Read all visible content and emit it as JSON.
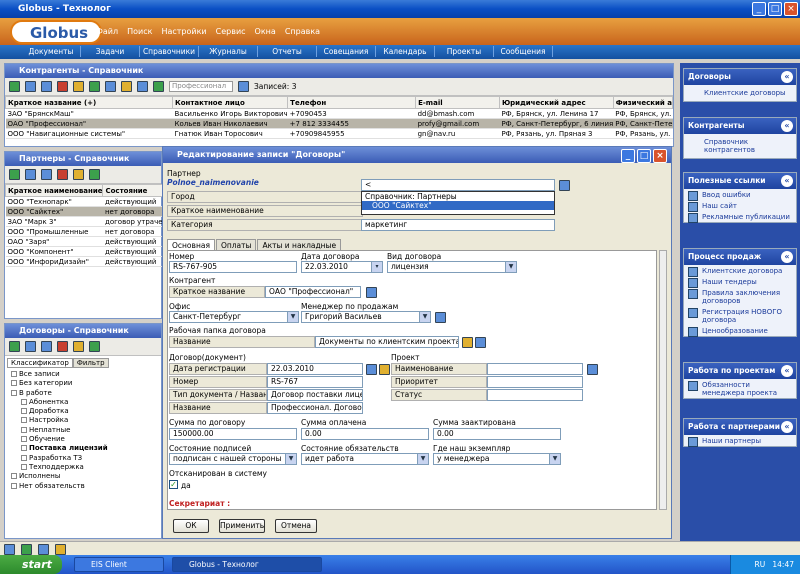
{
  "window": {
    "title": "Globus - Технолог"
  },
  "app": {
    "logo": "Globus",
    "menu": [
      "Файл",
      "Поиск",
      "Настройки",
      "Сервис",
      "Окна",
      "Справка"
    ]
  },
  "nav": {
    "tabs": [
      "Документы",
      "Задачи",
      "Справочники",
      "Журналы",
      "Отчеты",
      "Совещания",
      "Календарь",
      "Проекты",
      "Сообщения"
    ]
  },
  "contractors": {
    "title": "Контрагенты - Справочник",
    "filter_placeholder": "Профессионал",
    "records_label": "Записей: 3",
    "columns": [
      "Краткое название (+)",
      "Контактное лицо",
      "Телефон",
      "E-mail",
      "Юридический адрес",
      "Физический а"
    ],
    "rows": [
      [
        "ЗАО \"БрянскМаш\"",
        "Васильенко Игорь Викторович",
        "+7090453",
        "dd@bmash.com",
        "РФ, Брянск, ул. Ленина 17",
        "РФ, Брянск, ул."
      ],
      [
        "ОАО \"Профессионал\"",
        "Кольев Иван Николаевич",
        "+7 812 3334455",
        "profy@gmail.com",
        "РФ, Санкт-Петербург, 6 линия",
        "РФ, Санкт-Пете"
      ],
      [
        "ООО \"Навигационные системы\"",
        "Гнатюк Иван Торосович",
        "+70909845955",
        "gn@nav.ru",
        "РФ, Рязань, ул. Пряная 3",
        "РФ, Рязань, ул."
      ]
    ]
  },
  "partners": {
    "title": "Партнеры - Справочник",
    "columns": [
      "Краткое наименование",
      "Состояние"
    ],
    "rows": [
      [
        "ООО \"Технопарк\"",
        "действующий"
      ],
      [
        "ООО \"Сайктех\"",
        "нет договора"
      ],
      [
        "ЗАО \"Марк 3\"",
        "договор утрачен"
      ],
      [
        "ООО \"Промышленные",
        "нет договора"
      ],
      [
        "ОАО \"Заря\"",
        "действующий"
      ],
      [
        "ООО \"Компонент\"",
        "действующий"
      ],
      [
        "ООО \"ИнфориДизайн\"",
        "действующий"
      ]
    ]
  },
  "contracts": {
    "title": "Договоры - Справочник",
    "tabs": [
      "Классификатор",
      "Фильтр"
    ],
    "tree": [
      "Все записи",
      "Без категории",
      "В работе",
      "Абонентка",
      "Доработка",
      "Настройка",
      "Неплатные",
      "Обучение",
      "Поставка лицензий",
      "Разработка ТЗ",
      "Техподдержка",
      "Исполнены",
      "Нет обязательств"
    ]
  },
  "dialog": {
    "title": "Редактирование записи \"Договоры\"",
    "partner_label": "Партнер",
    "partner_field": "Polnoe_naimenovanie",
    "city_label": "Город",
    "short_label": "Краткое наименование",
    "category_label": "Категория",
    "category_value": "маркетинг",
    "dropdown": [
      "Справочник: Партнеры",
      "ООО \"Сайктех\""
    ],
    "tabs": [
      "Основная",
      "Оплаты",
      "Акты и накладные"
    ],
    "number_label": "Номер",
    "number_value": "RS-767-905",
    "date_label": "Дата договора",
    "date_value": "22.03.2010",
    "kind_label": "Вид договора",
    "kind_value": "лицензия",
    "contractor_label": "Контрагент",
    "contractor_short_label": "Краткое название",
    "contractor_value": "ОАО \"Профессионал\"",
    "office_label": "Офис",
    "office_value": "Санкт-Петербург",
    "manager_label": "Менеджер по продажам",
    "manager_value": "Григорий Васильев",
    "folder_label": "Рабочая папка договора",
    "folder_name_label": "Название",
    "folder_value": "Документы по клиентским проектам",
    "doc_label": "Договор(документ)",
    "doc_rows": [
      [
        "Дата регистрации",
        "22.03.2010"
      ],
      [
        "Номер",
        "RS-767"
      ],
      [
        "Тип документа / Название",
        "Договор поставки лицензий"
      ],
      [
        "Название",
        "Профессионал. Договор на"
      ]
    ],
    "project_label": "Проект",
    "project_rows": [
      "Наименование",
      "Приоритет",
      "Статус"
    ],
    "sum_label": "Сумма по договору",
    "sum_value": "150000.00",
    "paid_label": "Сумма оплачена",
    "paid_value": "0.00",
    "acted_label": "Сумма заактирована",
    "acted_value": "0.00",
    "sign_label": "Состояние подписей",
    "sign_value": "подписан с нашей стороны",
    "oblig_label": "Состояние обязательств",
    "oblig_value": "идет работа",
    "copy_label": "Где наш экземпляр",
    "copy_value": "у менеджера",
    "scan_label": "Отсканирован в систему",
    "scan_value": "да",
    "secretary_label": "Секретариат :",
    "btn_ok": "ОК",
    "btn_apply": "Применить",
    "btn_cancel": "Отмена"
  },
  "right": {
    "blocks": [
      {
        "title": "Договоры",
        "items": [
          "Клиентские договоры"
        ]
      },
      {
        "title": "Контрагенты",
        "items": [
          "Справочник контрагентов"
        ]
      },
      {
        "title": "Полезные ссылки",
        "items": [
          "Ввод ошибки",
          "Наш сайт",
          "Рекламные публикации"
        ]
      },
      {
        "title": "Процесс продаж",
        "items": [
          "Клиентские договора",
          "Наши тендеры",
          "Правила заключения договоров",
          "Регистрация НОВОГО договора",
          "Ценообразование"
        ]
      },
      {
        "title": "Работа по проектам",
        "items": [
          "Обязанности менеджера проекта"
        ]
      },
      {
        "title": "Работа с партнерами",
        "items": [
          "Наши партнеры"
        ]
      }
    ]
  },
  "taskbar": {
    "start": "start",
    "tasks": [
      "EIS Client",
      "Globus - Технолог"
    ],
    "lang": "RU",
    "time": "14:47"
  }
}
